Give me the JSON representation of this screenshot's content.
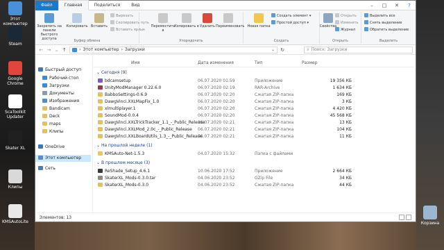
{
  "desktop": {
    "icons": [
      {
        "label": "Этот компьютер",
        "color": "#4a90d9"
      },
      {
        "label": "Steam",
        "color": "#1b2838"
      },
      {
        "label": "Google Chrome",
        "color": "#e0463a"
      },
      {
        "label": "ScaToolkit Updater",
        "color": "#ffffff"
      },
      {
        "label": "Skater XL",
        "color": "#202020"
      },
      {
        "label": "Клипы",
        "color": "#d9d9d9"
      },
      {
        "label": "KMSAutoLite",
        "color": "#e8e8e8"
      }
    ],
    "right_icons": [
      {
        "label": "Корзина",
        "color": "#9bb7cf"
      }
    ]
  },
  "window": {
    "tabs": [
      "Файл",
      "Главная",
      "Поделиться",
      "Вид"
    ],
    "controls": [
      "–",
      "□",
      "✕"
    ],
    "help": "?"
  },
  "ribbon": {
    "clipboard": {
      "group_label": "Буфер обмена",
      "pin": "Закрепить на панели быстрого доступа",
      "copy": "Копировать",
      "paste": "Вставить",
      "cut": "Вырезать",
      "copy_path": "Скопировать путь",
      "paste_shortcut": "Вставить ярлык"
    },
    "organize": {
      "group_label": "Упорядочить",
      "move_to": "Переместить в",
      "copy_to": "Копировать в",
      "delete": "Удалить",
      "rename": "Переименовать"
    },
    "create": {
      "group_label": "Создать",
      "new_folder": "Новая папка",
      "new_item": "Создать элемент",
      "easy_access": "Простой доступ"
    },
    "open": {
      "group_label": "Открыть",
      "properties": "Свойства",
      "open": "Открыть",
      "edit": "Изменить",
      "history": "Журнал"
    },
    "select": {
      "group_label": "Выделить",
      "select_all": "Выделить все",
      "select_none": "Снять выделение",
      "invert": "Обратить выделение"
    }
  },
  "address": {
    "path": [
      "Этот компьютер",
      "Загрузки"
    ],
    "search_placeholder": "Поиск: Загрузки"
  },
  "nav": [
    {
      "label": "Быстрый доступ",
      "color": "#3a78c2"
    },
    {
      "label": "Рабочий стол",
      "color": "#3a8bd8"
    },
    {
      "label": "Загрузки",
      "color": "#3a8bd8"
    },
    {
      "label": "Документы",
      "color": "#8a9bb0"
    },
    {
      "label": "Изображения",
      "color": "#4a90d9"
    },
    {
      "label": "Bandicam",
      "color": "#e8c05a"
    },
    {
      "label": "Deck",
      "color": "#e8c05a"
    },
    {
      "label": "maps",
      "color": "#e8c05a"
    },
    {
      "label": "Клипы",
      "color": "#e8c05a"
    },
    {
      "label": "OneDrive",
      "color": "#2f7ad1"
    },
    {
      "label": "Этот компьютер",
      "color": "#5a8fcf"
    },
    {
      "label": "Сеть",
      "color": "#4a7fbf"
    }
  ],
  "columns": {
    "name": "Имя",
    "date": "Дата изменения",
    "type": "Тип",
    "size": "Размер"
  },
  "groups": [
    {
      "title": "Сегодня (9)",
      "files": [
        {
          "name": "bdcamsetup",
          "date": "06.07.2020 01:59",
          "type": "Приложение",
          "size": "19 356 КБ",
          "icon": "#7a5bd6"
        },
        {
          "name": "UnityModManager 0.22.6.0",
          "date": "06.07.2020 02:19",
          "type": "RAR-Archive",
          "size": "1 634 КБ",
          "icon": "#a0364a"
        },
        {
          "name": "BabboSettings-0.6.9",
          "date": "06.07.2020 02:20",
          "type": "Сжатая ZIP-папка",
          "size": "169 КБ",
          "icon": "#e8c05a"
        },
        {
          "name": "DawgVinci.XXLMapFix_1.0",
          "date": "06.07.2020 02:20",
          "type": "Сжатая ZIP-папка",
          "size": "3 КБ",
          "icon": "#e8c05a"
        },
        {
          "name": "xlmultiplayer.1",
          "date": "06.07.2020 02:20",
          "type": "Сжатая ZIP-папка",
          "size": "4 420 КБ",
          "icon": "#e8c05a"
        },
        {
          "name": "SoundMod-0.0.4",
          "date": "06.07.2020 02:20",
          "type": "Сжатая ZIP-папка",
          "size": "45 568 КБ",
          "icon": "#e8c05a"
        },
        {
          "name": "DawgVinci.XXLTrickTracker_1.1_-_Public_Release",
          "date": "06.07.2020 02:21",
          "type": "Сжатая ZIP-папка",
          "size": "13 КБ",
          "icon": "#e8c05a"
        },
        {
          "name": "DawgVinci.XXLMod_2.0c_-_Public_Release",
          "date": "06.07.2020 02:21",
          "type": "Сжатая ZIP-папка",
          "size": "104 КБ",
          "icon": "#e8c05a"
        },
        {
          "name": "DawgVinci.XXLBoardUtils_1.3_-_Public_Release",
          "date": "06.07.2020 02:21",
          "type": "Сжатая ZIP-папка",
          "size": "11 КБ",
          "icon": "#e8c05a"
        }
      ]
    },
    {
      "title": "На прошлой неделе (1)",
      "files": [
        {
          "name": "KMSAuto-Net-1.5.3",
          "date": "04.07.2020 15:32",
          "type": "Папка с файлами",
          "size": "",
          "icon": "#f0c850"
        }
      ]
    },
    {
      "title": "В прошлом месяце (3)",
      "files": [
        {
          "name": "ReShade_Setup_4.6.1",
          "date": "10.06.2020 17:52",
          "type": "Приложение",
          "size": "2 664 КБ",
          "icon": "#3a3a3a"
        },
        {
          "name": "SkaterXL_Mods-0.3.0.tar",
          "date": "04.06.2020 23:52",
          "type": "GZip File",
          "size": "34 КБ",
          "icon": "#8a8a8a"
        },
        {
          "name": "SkaterXL_Mods-0.3.0",
          "date": "04.06.2020 23:52",
          "type": "Сжатая ZIP-папка",
          "size": "44 КБ",
          "icon": "#e8c05a"
        }
      ]
    }
  ],
  "status": {
    "count": "Элементов: 13"
  }
}
